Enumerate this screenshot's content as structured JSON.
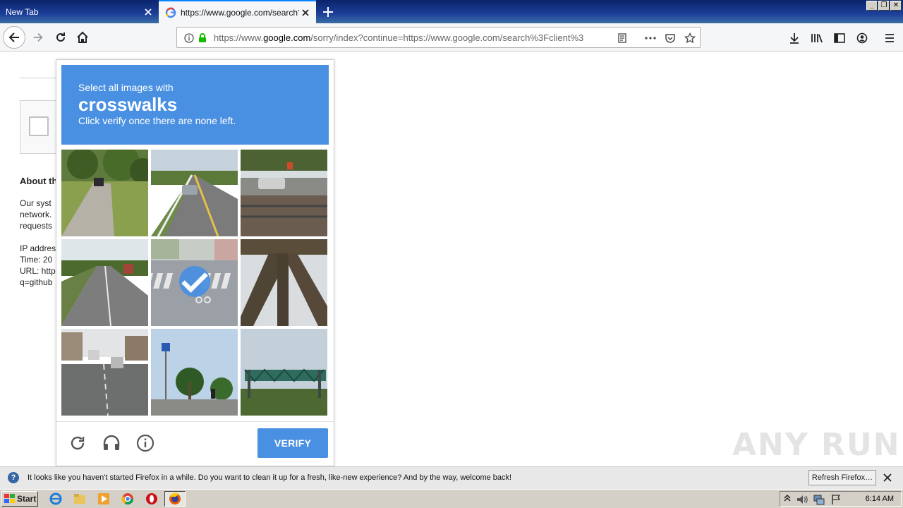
{
  "browser": {
    "tabs": [
      {
        "title": "New Tab",
        "active": false
      },
      {
        "title": "https://www.google.com/search?c",
        "active": true
      }
    ],
    "url": {
      "prefix": "https://www.",
      "domain": "google.com",
      "rest": "/sorry/index?continue=https://www.google.com/search%3Fclient%3"
    }
  },
  "page": {
    "about_heading": "About th",
    "lines": [
      "Our syst",
      "network.",
      "requests",
      "IP addres",
      "Time: 20",
      "URL: http",
      "q=github"
    ]
  },
  "captcha": {
    "instruction": "Select all images with",
    "keyword": "crosswalks",
    "hint": "Click verify once there are none left.",
    "verify_label": "VERIFY",
    "selected_tile": 5
  },
  "watermark": "ANY RUN",
  "notification": {
    "message": "It looks like you haven't started Firefox in a while. Do you want to clean it up for a fresh, like-new experience? And by the way, welcome back!",
    "button_label": "Refresh Firefox…"
  },
  "taskbar": {
    "start_label": "Start",
    "clock": "6:14 AM"
  },
  "colors": {
    "captcha_blue": "#4a90e2",
    "tab_accent": "#0a84ff"
  }
}
